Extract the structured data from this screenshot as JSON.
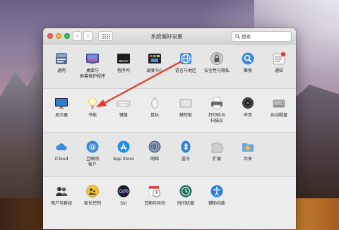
{
  "window": {
    "title": "系统偏好设置",
    "search_placeholder": "搜索"
  },
  "rows": [
    [
      {
        "label": "通用",
        "icon": "general-icon"
      },
      {
        "label": "桌面与\n屏幕保护程序",
        "icon": "desktop-icon"
      },
      {
        "label": "程序坞",
        "icon": "dock-icon"
      },
      {
        "label": "调度中心",
        "icon": "mission-control-icon"
      },
      {
        "label": "语言与地区",
        "icon": "language-region-icon"
      },
      {
        "label": "安全性与隐私",
        "icon": "security-icon"
      },
      {
        "label": "聚焦",
        "icon": "spotlight-icon"
      },
      {
        "label": "通知",
        "icon": "notifications-icon"
      }
    ],
    [
      {
        "label": "显示器",
        "icon": "displays-icon"
      },
      {
        "label": "节能",
        "icon": "energy-saver-icon"
      },
      {
        "label": "键盘",
        "icon": "keyboard-icon"
      },
      {
        "label": "鼠标",
        "icon": "mouse-icon"
      },
      {
        "label": "触控板",
        "icon": "trackpad-icon"
      },
      {
        "label": "打印机与\n扫描仪",
        "icon": "printer-icon"
      },
      {
        "label": "声音",
        "icon": "sound-icon"
      },
      {
        "label": "启动磁盘",
        "icon": "startup-disk-icon"
      }
    ],
    [
      {
        "label": "iCloud",
        "icon": "icloud-icon"
      },
      {
        "label": "互联网\n帐户",
        "icon": "internet-accounts-icon"
      },
      {
        "label": "App Store",
        "icon": "app-store-icon"
      },
      {
        "label": "网络",
        "icon": "network-icon"
      },
      {
        "label": "蓝牙",
        "icon": "bluetooth-icon"
      },
      {
        "label": "扩展",
        "icon": "extensions-icon"
      },
      {
        "label": "共享",
        "icon": "sharing-icon"
      }
    ],
    [
      {
        "label": "用户与群组",
        "icon": "users-groups-icon"
      },
      {
        "label": "家长控制",
        "icon": "parental-controls-icon"
      },
      {
        "label": "Siri",
        "icon": "siri-icon"
      },
      {
        "label": "日期与时间",
        "icon": "date-time-icon"
      },
      {
        "label": "时间机器",
        "icon": "time-machine-icon"
      },
      {
        "label": "辅助功能",
        "icon": "accessibility-icon"
      }
    ]
  ],
  "colors": {
    "annotation_arrow": "#e8382c",
    "close": "#fc605b",
    "minimize": "#fdbc40",
    "maximize": "#34c84a"
  }
}
